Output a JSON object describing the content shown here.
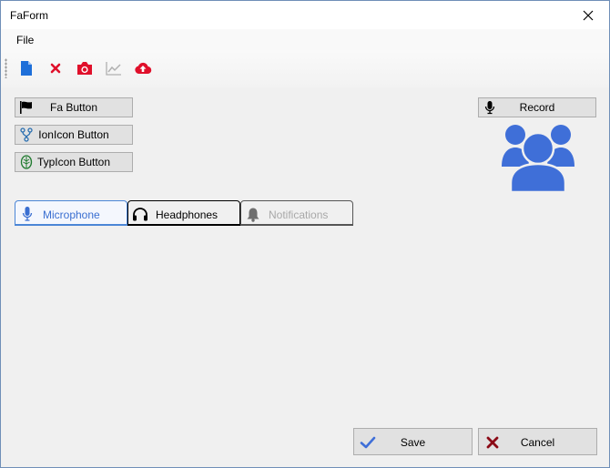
{
  "window": {
    "title": "FaForm"
  },
  "menu": {
    "file_label": "File"
  },
  "toolbar": {
    "items": [
      {
        "icon": "file-icon",
        "color": "#1e6fd9"
      },
      {
        "icon": "x-icon",
        "color": "#e0102b"
      },
      {
        "icon": "camera-icon",
        "color": "#e0102b"
      },
      {
        "icon": "line-chart-icon",
        "color": "#b0b0b0"
      },
      {
        "icon": "cloud-upload-icon",
        "color": "#e0102b"
      }
    ]
  },
  "buttons": {
    "fa_label": "Fa Button",
    "ionicon_label": "IonIcon Button",
    "typicon_label": "TypIcon Button",
    "record_label": "Record"
  },
  "tabs": [
    {
      "label": "Microphone",
      "icon": "microphone-icon",
      "state": "active"
    },
    {
      "label": "Headphones",
      "icon": "headphones-icon",
      "state": "normal"
    },
    {
      "label": "Notifications",
      "icon": "bell-icon",
      "state": "disabled"
    }
  ],
  "footer": {
    "save_label": "Save",
    "cancel_label": "Cancel"
  },
  "colors": {
    "accent": "#3a6fd1",
    "users_icon": "#3f6fd8",
    "save_check": "#3f6fd8",
    "cancel_x": "#8b0a16"
  }
}
